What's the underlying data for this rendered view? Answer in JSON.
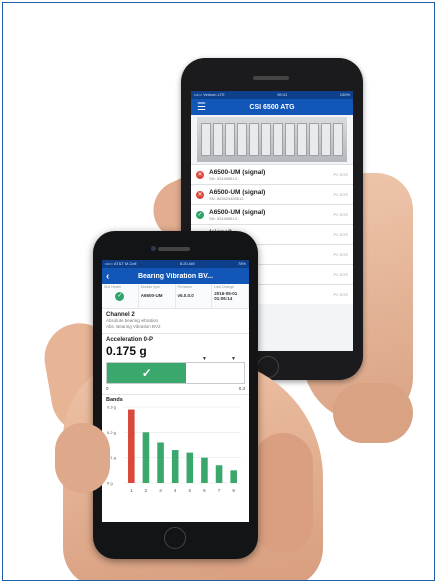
{
  "back_phone": {
    "status_left": "••••○ Verizon LTE",
    "status_time": "09:41",
    "status_right": "100%",
    "app_title": "CSI 6500 ATG",
    "menu_icon": "hamburger-menu-icon",
    "items": [
      {
        "name": "A6500-UM (signal)",
        "sn": "SN: 324455513",
        "slot": "P2 SOS",
        "status": "error"
      },
      {
        "name": "A6500-UM (signal)",
        "sn": "SN: 843524455513",
        "slot": "P2 SOS",
        "status": "error"
      },
      {
        "name": "A6500-UM (signal)",
        "sn": "SN: 324455513",
        "slot": "P2 SOS",
        "status": "ok"
      },
      {
        "name": "(signal)",
        "sn": "SN: 4455513",
        "slot": "P2 SOS",
        "status": "none"
      },
      {
        "name": "(signal)",
        "sn": "SN: 4455513",
        "slot": "P2 SOS",
        "status": "none"
      },
      {
        "name": "(signal)",
        "sn": "SN: 4455513",
        "slot": "P2 SOS",
        "status": "none"
      },
      {
        "name": "(signal)",
        "sn": "SN: 4455513",
        "slot": "P2 SOS",
        "status": "none"
      }
    ]
  },
  "front_phone": {
    "status_left": "••••○ AT&T M-Cell",
    "status_time": "8:20 AM",
    "status_right": "78%",
    "title": "Bearing Vibration BV...",
    "meta": {
      "health_label": "Slot Health",
      "module_label": "Module type",
      "module_value": "A6500-UM",
      "firmware_label": "Firmware",
      "firmware_value": "v5.0.0.0",
      "last_change_label": "Last Change",
      "last_change_value": "2016-05-01 01:06:14"
    },
    "channel": {
      "title": "Channel 2",
      "desc1": "Absolute bearing vibration",
      "desc2": "Abs. Bearing Vibration BV2"
    },
    "acceleration": {
      "label": "Acceleration 0-P",
      "value": "0.175 g",
      "min_label": "0",
      "max_label": "0.3",
      "level_fraction": 0.58,
      "fill_color": "#3aa76d"
    },
    "bands_title": "Bands"
  },
  "chart_data": {
    "type": "bar",
    "title": "Bands",
    "categories": [
      "1",
      "2",
      "3",
      "4",
      "5",
      "6",
      "7",
      "8"
    ],
    "values": [
      0.29,
      0.2,
      0.16,
      0.13,
      0.12,
      0.1,
      0.07,
      0.05
    ],
    "colors": [
      "#d9483b",
      "#3aa76d",
      "#3aa76d",
      "#3aa76d",
      "#3aa76d",
      "#3aa76d",
      "#3aa76d",
      "#3aa76d"
    ],
    "yticks": [
      "0.3 g",
      "0.2 g",
      "0.1 g",
      "0 g"
    ],
    "ylim": [
      0,
      0.3
    ],
    "grid": true
  }
}
